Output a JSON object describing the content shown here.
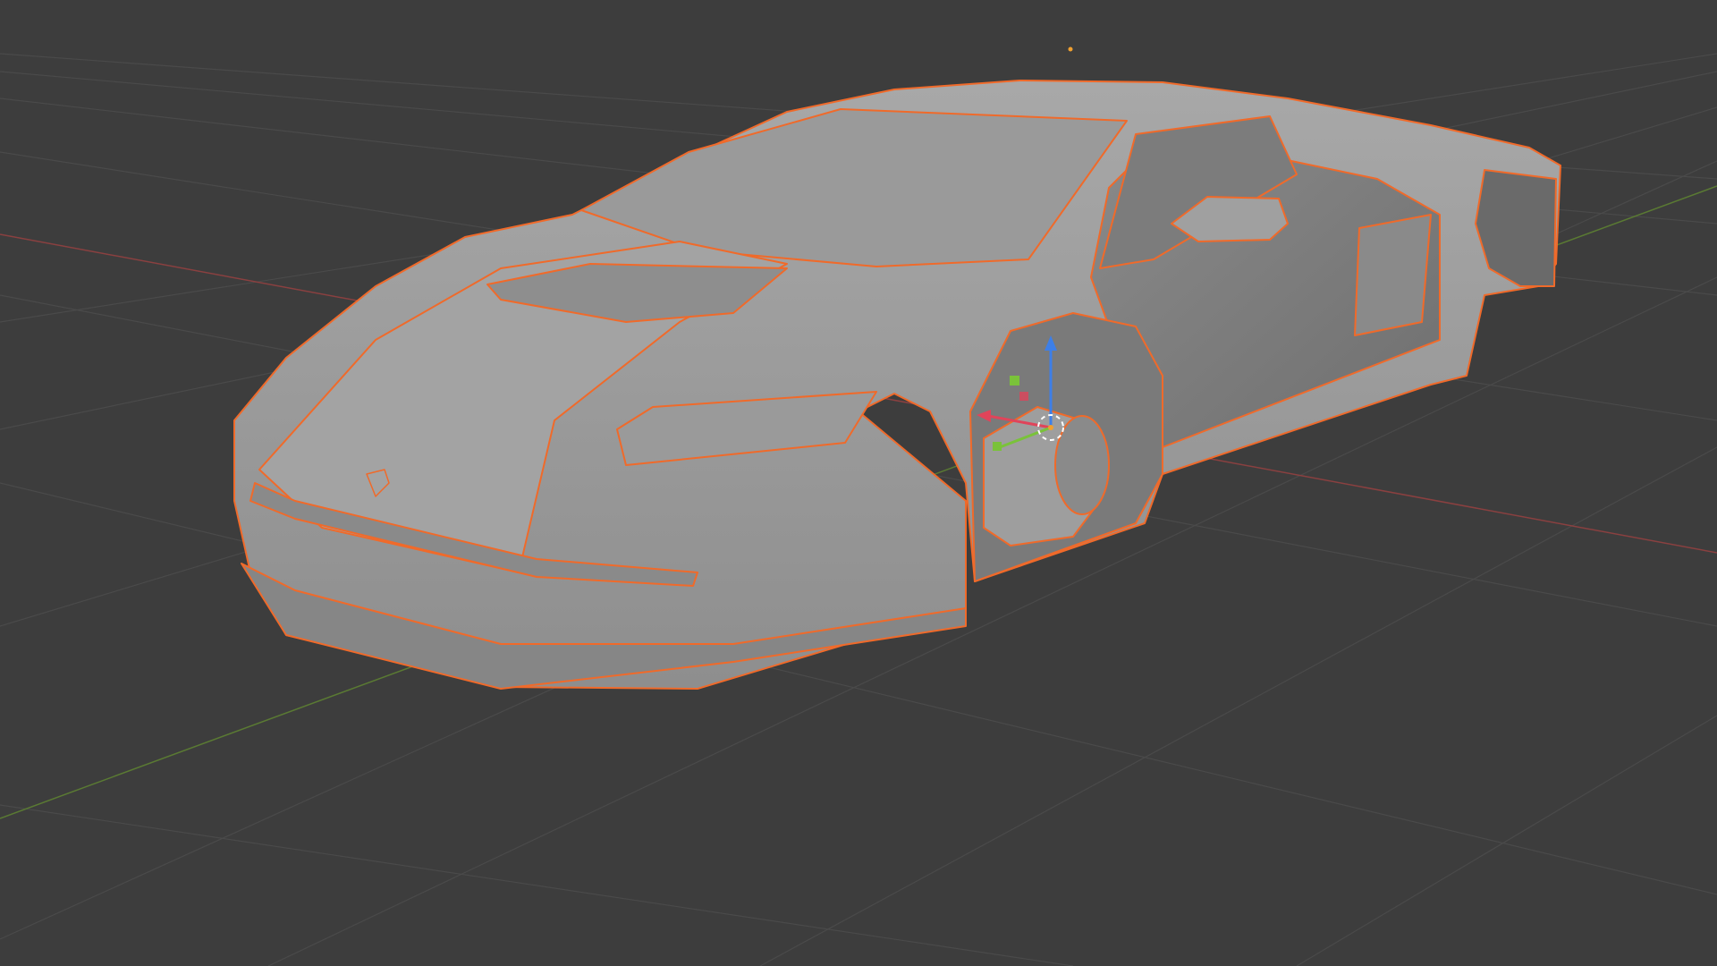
{
  "app": {
    "type": "3d-viewport",
    "background_color": "#3d3d3d"
  },
  "viewport": {
    "grid": true,
    "grid_color": "#4a4a4a",
    "x_axis_color": "#8a4040",
    "y_axis_color": "#5a7a33",
    "selection_outline_color": "#f06a2a",
    "model_color": "#9c9c9c",
    "selected_object": "car body",
    "gizmo": {
      "type": "move",
      "axes": [
        "x",
        "y",
        "z"
      ],
      "colors": {
        "x": "#e0445a",
        "y": "#7ac23a",
        "z": "#3d7fe8"
      }
    },
    "object_origin_icon": "origin-dot-icon",
    "cursor_icon": "3d-cursor-icon"
  }
}
